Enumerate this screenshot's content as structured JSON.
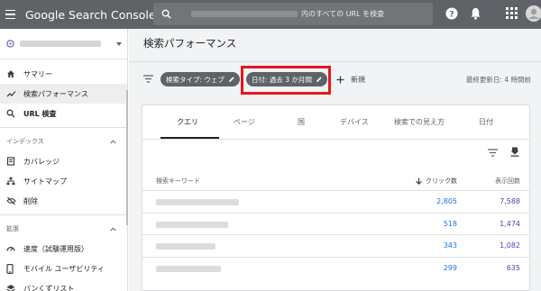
{
  "app": {
    "name": "Google Search Console"
  },
  "search": {
    "suffix": "内のすべての URL を検査"
  },
  "sidebar": {
    "items": [
      {
        "label": "サマリー",
        "icon": "home-icon"
      },
      {
        "label": "検索パフォーマンス",
        "icon": "trending-icon"
      },
      {
        "label": "URL 検査",
        "icon": "search-icon"
      }
    ],
    "sections": [
      {
        "title": "インデックス",
        "items": [
          {
            "label": "カバレッジ",
            "icon": "coverage-icon"
          },
          {
            "label": "サイトマップ",
            "icon": "sitemap-icon"
          },
          {
            "label": "削除",
            "icon": "removal-icon"
          }
        ]
      },
      {
        "title": "拡張",
        "items": [
          {
            "label": "速度（試験運用版）",
            "icon": "speed-icon"
          },
          {
            "label": "モバイル ユーザビリティ",
            "icon": "mobile-icon"
          },
          {
            "label": "パンくずリスト",
            "icon": "layers-icon"
          }
        ]
      }
    ]
  },
  "main": {
    "title": "検索パフォーマンス",
    "filters": {
      "search_type": "検索タイプ: ウェブ",
      "date": "日付: 過去 3 か月間",
      "new_label": "新規"
    },
    "last_updated": "最終更新日: 4 時間前",
    "tabs": [
      "クエリ",
      "ページ",
      "国",
      "デバイス",
      "検索での見え方",
      "日付"
    ],
    "table": {
      "headers": {
        "query": "検索キーワード",
        "clicks": "クリック数",
        "impressions": "表示回数"
      },
      "rows": [
        {
          "clicks": "2,805",
          "impressions": "7,588"
        },
        {
          "clicks": "518",
          "impressions": "1,474"
        },
        {
          "clicks": "343",
          "impressions": "1,082"
        },
        {
          "clicks": "299",
          "impressions": "635"
        }
      ]
    }
  },
  "colors": {
    "topbar": "#5f6368",
    "highlight": "#e8161b",
    "clicks": "#1a73e8",
    "impressions": "#5e35b1"
  }
}
